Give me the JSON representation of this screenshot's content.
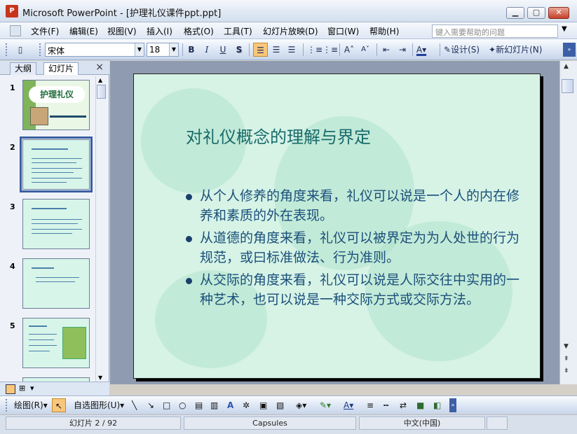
{
  "window": {
    "title": "Microsoft PowerPoint - [护理礼仪课件ppt.ppt]",
    "minimize": "▁",
    "maximize": "▢",
    "close": "✕"
  },
  "menu": {
    "items": [
      "文件(F)",
      "编辑(E)",
      "视图(V)",
      "插入(I)",
      "格式(O)",
      "工具(T)",
      "幻灯片放映(D)",
      "窗口(W)",
      "帮助(H)"
    ],
    "help_placeholder": "键入需要帮助的问题"
  },
  "toolbar": {
    "font_name": "宋体",
    "font_size": "18",
    "bold": "B",
    "italic": "I",
    "underline": "U",
    "shadow": "S",
    "design_label": "设计(S)",
    "new_slide_label": "新幻灯片(N)"
  },
  "left_panel": {
    "tab_outline": "大纲",
    "tab_slides": "幻灯片",
    "close": "×",
    "slide_numbers": [
      "1",
      "2",
      "3",
      "4",
      "5"
    ],
    "thumb1_title": "护理礼仪"
  },
  "slide": {
    "title": "对礼仪概念的理解与界定",
    "bullets": [
      "从个人修养的角度来看，礼仪可以说是一个人的内在修养和素质的外在表现。",
      "从道德的角度来看，礼仪可以被界定为为人处世的行为规范，或曰标准做法、行为准则。",
      "从交际的角度来看，礼仪可以说是人际交往中实用的一种艺术，也可以说是一种交际方式或交际方法。"
    ]
  },
  "drawing": {
    "draw_label": "绘图(R)",
    "autoshape_label": "自选图形(U)"
  },
  "status": {
    "slide_position": "幻灯片 2 / 92",
    "theme": "Capsules",
    "language": "中文(中国)"
  },
  "colors": {
    "slide_background": "#d6f3e6",
    "title_color": "#196b6b",
    "bullet_text_color": "#1a4f7a"
  }
}
